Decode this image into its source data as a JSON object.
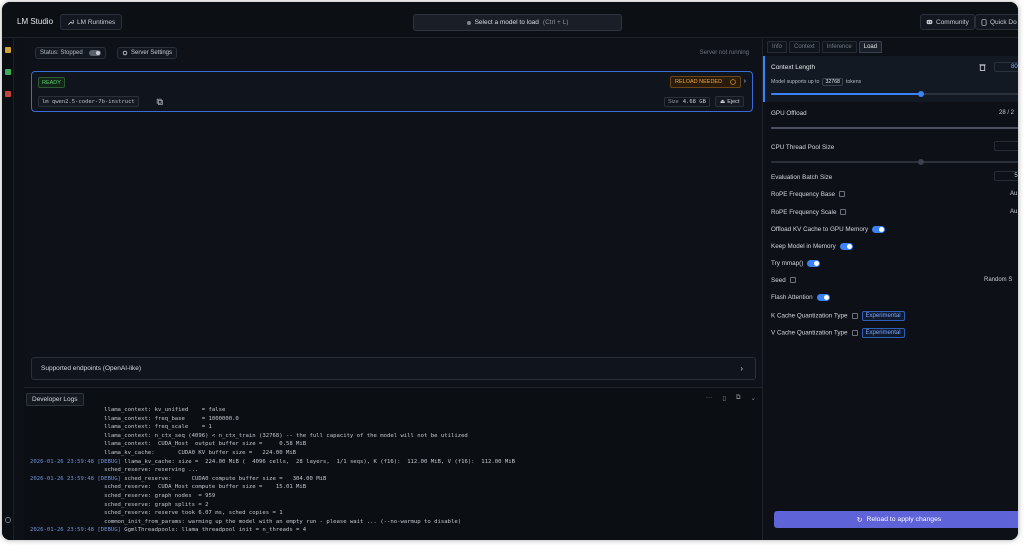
{
  "app": {
    "name": "LM Studio",
    "runtimes_label": "LM Runtimes",
    "model_select_label": "Select a model to load",
    "model_select_shortcut": "(Ctrl + L)",
    "community_label": "Community",
    "quick_label": "Quick Do"
  },
  "server": {
    "status_label": "Status: Stopped",
    "settings_label": "Server Settings",
    "status_text": "Server not running"
  },
  "model_card": {
    "ready_badge": "READY",
    "reload_badge": "RELOAD NEEDED",
    "model_id": "lm qwen2.5-coder-7b-instruct",
    "size_label": "Size",
    "size_value": "4.68 GB",
    "eject_label": "Eject"
  },
  "endpoints": {
    "label": "Supported endpoints (OpenAI-like)"
  },
  "logs": {
    "tab_label": "Developer Logs",
    "lines": [
      {
        "ts": "",
        "text": "                      llama_context: kv_unified    = false"
      },
      {
        "ts": "",
        "text": "                      llama_context: freq_base     = 1000000.0"
      },
      {
        "ts": "",
        "text": "                      llama_context: freq_scale    = 1"
      },
      {
        "ts": "",
        "text": "                      llama_context: n_ctx_seq (4096) < n_ctx_train (32768) -- the full capacity of the model will not be utilized"
      },
      {
        "ts": "",
        "text": "                      llama_context:  CUDA_Host  output buffer size =     0.58 MiB"
      },
      {
        "ts": "",
        "text": "                      llama_kv_cache:       CUDA0 KV buffer size =   224.00 MiB"
      },
      {
        "ts": "2026-01-26 23:59:48 [DEBUG]",
        "text": " llama_kv_cache: size =  224.00 MiB (  4096 cells,  28 layers,  1/1 seqs), K (f16):  112.00 MiB, V (f16):  112.00 MiB"
      },
      {
        "ts": "",
        "text": "                      sched_reserve: reserving ..."
      },
      {
        "ts": "2026-01-26 23:59:48 [DEBUG]",
        "text": " sched_reserve:      CUDA0 compute buffer size =   304.00 MiB"
      },
      {
        "ts": "",
        "text": "                      sched_reserve:  CUDA_Host compute buffer size =    15.01 MiB"
      },
      {
        "ts": "",
        "text": "                      sched_reserve: graph nodes  = 959"
      },
      {
        "ts": "",
        "text": "                      sched_reserve: graph splits = 2"
      },
      {
        "ts": "",
        "text": "                      sched_reserve: reserve took 6.07 ms, sched copies = 1"
      },
      {
        "ts": "",
        "text": "                      common_init_from_params: warming up the model with an empty run - please wait ... (--no-warmup to disable)"
      },
      {
        "ts": "2026-01-26 23:59:48 [DEBUG]",
        "text": " GgmlThreadpools: llama threadpool init = n_threads = 4"
      }
    ]
  },
  "panel": {
    "tabs": [
      "Info",
      "Context",
      "Inference",
      "Load"
    ],
    "active_tab": "Load",
    "context_length": {
      "label": "Context Length",
      "value": "800",
      "sub_prefix": "Model supports up to",
      "sub_value": "32768",
      "sub_suffix": "tokens",
      "slider_fraction": 0.6
    },
    "gpu_offload": {
      "label": "GPU Offload",
      "value": "28 / 2",
      "slider_fraction": 1.0
    },
    "cpu_threads": {
      "label": "CPU Thread Pool Size",
      "value": "",
      "slider_fraction": 0.6
    },
    "eval_batch": {
      "label": "Evaluation Batch Size",
      "value": "51"
    },
    "rope_base": {
      "label": "RoPE Frequency Base",
      "right": "Au"
    },
    "rope_scale": {
      "label": "RoPE Frequency Scale",
      "right": "Au"
    },
    "offload_kv": {
      "label": "Offload KV Cache to GPU Memory"
    },
    "keep_in_memory": {
      "label": "Keep Model in Memory"
    },
    "try_mmap": {
      "label": "Try mmap()"
    },
    "seed": {
      "label": "Seed",
      "right": "Random S"
    },
    "flash_attention": {
      "label": "Flash Attention"
    },
    "k_cache": {
      "label": "K Cache Quantization Type",
      "badge": "Experimental"
    },
    "v_cache": {
      "label": "V Cache Quantization Type",
      "badge": "Experimental"
    },
    "apply_button": "Reload to apply changes"
  },
  "colors": {
    "accent": "#3b82f6",
    "ready": "#59d36a",
    "warning": "#f0a532",
    "apply_button": "#5f63d8"
  }
}
